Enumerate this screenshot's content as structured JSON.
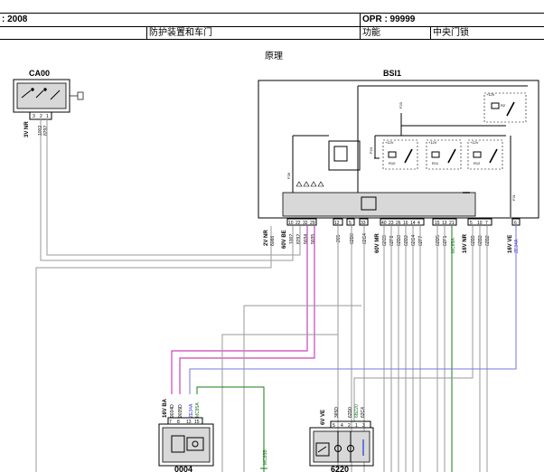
{
  "header": {
    "date": ": 2008",
    "opr": "OPR : 99999",
    "category": "防护装置和车门",
    "function_label": "功能",
    "function_value": "中央门锁",
    "section": "原理"
  },
  "components": {
    "ca00": {
      "name": "CA00",
      "connector_label": "3V NR",
      "pins": [
        "3",
        "2",
        "1"
      ],
      "wires": [
        "1002",
        "8292"
      ]
    },
    "bsi1": {
      "name": "BSI1",
      "fuses": [
        "F23",
        "F24",
        "F28",
        "F21"
      ],
      "relays": [
        "R2",
        "R10",
        "R11",
        "R12"
      ],
      "supply": "+12V",
      "conn_a": {
        "label": "2V NR",
        "pins": [],
        "wires": [
          "8086"
        ]
      },
      "conn_b": {
        "label": "60V BE",
        "pins": [
          "10",
          "22",
          "32",
          "29"
        ],
        "wires": [
          "1002",
          "8292",
          "9034",
          "9035"
        ]
      },
      "single_pins": [
        {
          "pin": "12",
          "wire": "265"
        },
        {
          "pin": "5",
          "wire": "62D0"
        },
        {
          "pin": "33",
          "wire": "62C4"
        }
      ],
      "conn_c": {
        "label": "60V MR",
        "pins": [
          "40",
          "23",
          "26",
          "16",
          "14",
          "4"
        ],
        "wires": [
          "62C9",
          "62F8",
          "62D3",
          "62D2",
          "62G4",
          "62F7"
        ]
      },
      "conn_d": {
        "pins": [
          "15",
          "13",
          "21"
        ],
        "wires": [
          "62D5",
          "62F1",
          "MC85A"
        ]
      },
      "conn_e": {
        "label": "16V NR",
        "pins": [
          "5",
          "10",
          "7"
        ],
        "wires": [
          "62B9",
          "62B3",
          "62B2"
        ]
      },
      "conn_f": {
        "label": "16V VE",
        "pins": [
          "6"
        ],
        "wires": [
          "ZE34A"
        ]
      }
    },
    "c0004": {
      "name": "0004",
      "connector_label": "16V BA",
      "pins": [
        "7",
        "8",
        "13",
        "15"
      ],
      "wires": [
        "9034D",
        "9035D",
        "ZE34A",
        "MC85A"
      ]
    },
    "c6220": {
      "name": "6220",
      "connector_label": "6V VE",
      "pins": [
        "5",
        "4",
        "2",
        "1",
        "3"
      ],
      "wires": [
        "365D",
        "62D0",
        "6BZ20",
        "62C4"
      ]
    },
    "ground": {
      "wire": "MC85B"
    }
  },
  "colors": {
    "wire": "#999999",
    "wire_magenta": "#cc44bb",
    "wire_blue": "#7777dd",
    "wire_green": "#1a7a1a",
    "component_fill": "#d8d8d8",
    "outline": "#000000"
  }
}
